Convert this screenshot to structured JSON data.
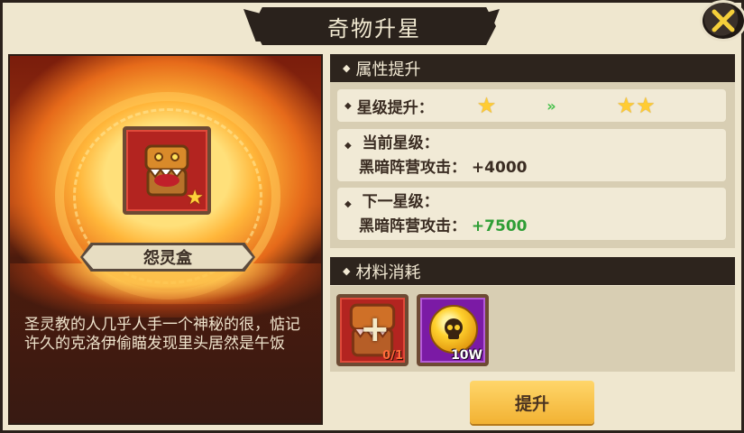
{
  "window": {
    "title": "奇物升星"
  },
  "item": {
    "name": "怨灵盒",
    "description": "圣灵教的人几乎人手一个神秘的很，惦记许久的克洛伊偷瞄发现里头居然是午饭"
  },
  "attributes": {
    "header": "属性提升",
    "star_label": "星级提升：",
    "current": {
      "label": "当前星级：",
      "stat": "黑暗阵营攻击：",
      "value": "+4000"
    },
    "next": {
      "label": "下一星级：",
      "stat": "黑暗阵营攻击：",
      "value": "+7500"
    }
  },
  "materials": {
    "header": "材料消耗",
    "items": [
      {
        "icon": "chest-monster-icon",
        "count": "0/1"
      },
      {
        "icon": "skull-coin-icon",
        "count": "10W"
      }
    ]
  },
  "upgrade_button": {
    "label": "提升"
  },
  "colors": {
    "accent_gold": "#f2b233",
    "bonus_green": "#2e9e35",
    "header_dark": "#2d241d"
  }
}
